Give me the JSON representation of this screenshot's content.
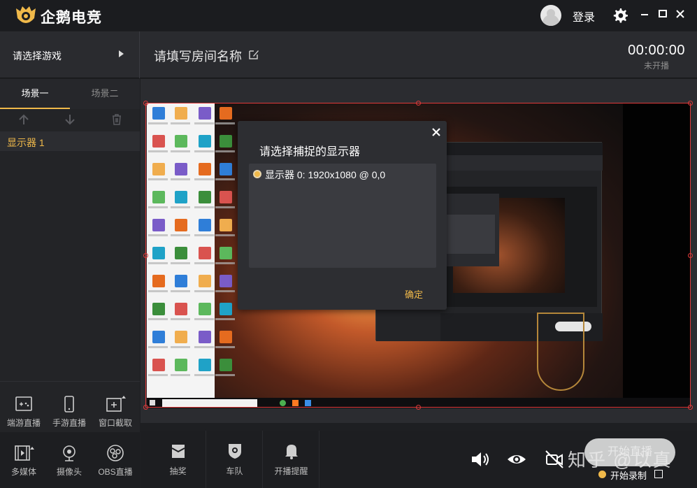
{
  "app": {
    "name": "企鹅电竞",
    "login": "登录"
  },
  "header": {
    "game_select": "请选择游戏",
    "room_name": "请填写房间名称",
    "timer": "00:00:00",
    "live_status": "未开播"
  },
  "scenes": {
    "tabs": [
      "场景一",
      "场景二"
    ],
    "sources": [
      "显示器 1"
    ]
  },
  "add_sources": [
    {
      "label": "端游直播",
      "icon": "gamepad-icon"
    },
    {
      "label": "手游直播",
      "icon": "phone-icon"
    },
    {
      "label": "窗口截取",
      "icon": "window-capture-icon"
    },
    {
      "label": "多媒体",
      "icon": "film-icon"
    },
    {
      "label": "摄像头",
      "icon": "webcam-icon"
    },
    {
      "label": "OBS直播",
      "icon": "obs-icon"
    }
  ],
  "bottom": {
    "lottery": "抽奖",
    "team": "车队",
    "reminder": "开播提醒",
    "start_live": "开始直播",
    "start_record": "开始录制"
  },
  "dialog": {
    "title": "请选择捕捉的显示器",
    "option": "显示器 0: 1920x1080 @ 0,0",
    "confirm": "确定"
  },
  "watermark": "知乎 @以真",
  "colors": {
    "accent": "#f0b94a",
    "selection": "#e03a3a",
    "bg": "#1e1f22"
  }
}
